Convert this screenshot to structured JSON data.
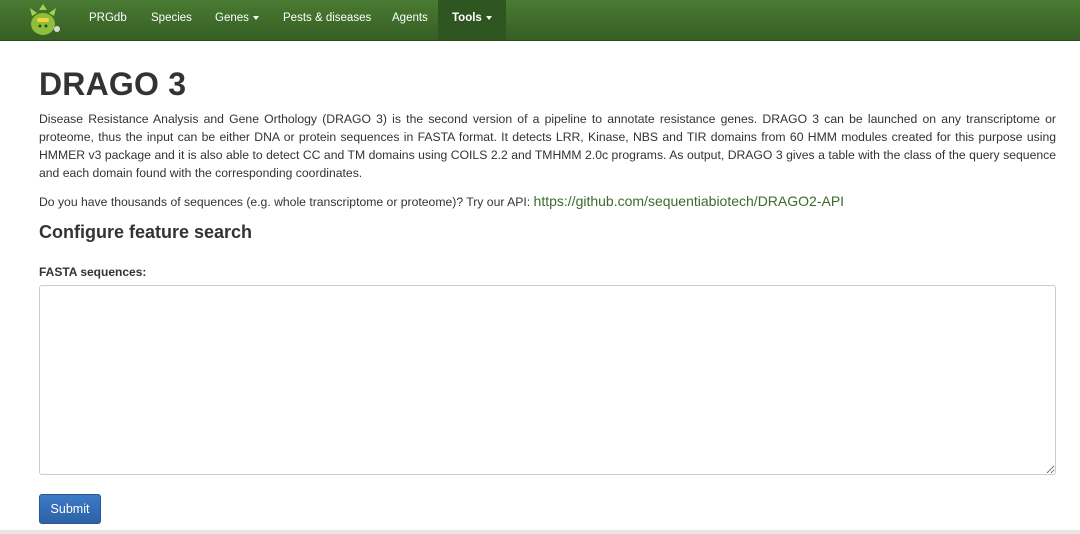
{
  "navbar": {
    "items": [
      {
        "label": "PRGdb"
      },
      {
        "label": "Species"
      },
      {
        "label": "Genes"
      },
      {
        "label": "Pests & diseases"
      },
      {
        "label": "Agents"
      },
      {
        "label": "Tools"
      }
    ],
    "active_item": "Tools",
    "color": "#3f6c2b"
  },
  "main": {
    "title": "DRAGO 3",
    "description": "Disease Resistance Analysis and Gene Orthology (DRAGO 3) is the second version of a pipeline to annotate resistance genes. DRAGO 3 can be launched on any transcriptome or proteome, thus the input can be either DNA or protein sequences in FASTA format. It detects LRR, Kinase, NBS and TIR domains from 60 HMM modules created for this purpose using HMMER v3 package and it is also able to detect CC and TM domains using COILS 2.2 and TMHMM 2.0c programs. As output, DRAGO 3 gives a table with the class of the query sequence and each domain found with the corresponding coordinates.",
    "api_text": "Do you have thousands of sequences (e.g. whole transcriptome or proteome)? Try our API: ",
    "api_link": "https://github.com/sequentiabiotech/DRAGO2-API",
    "section_title": "Configure feature search",
    "fasta_label": "FASTA sequences:",
    "fasta_value": "",
    "submit_label": "Submit",
    "submit_color": "#3370b7"
  }
}
